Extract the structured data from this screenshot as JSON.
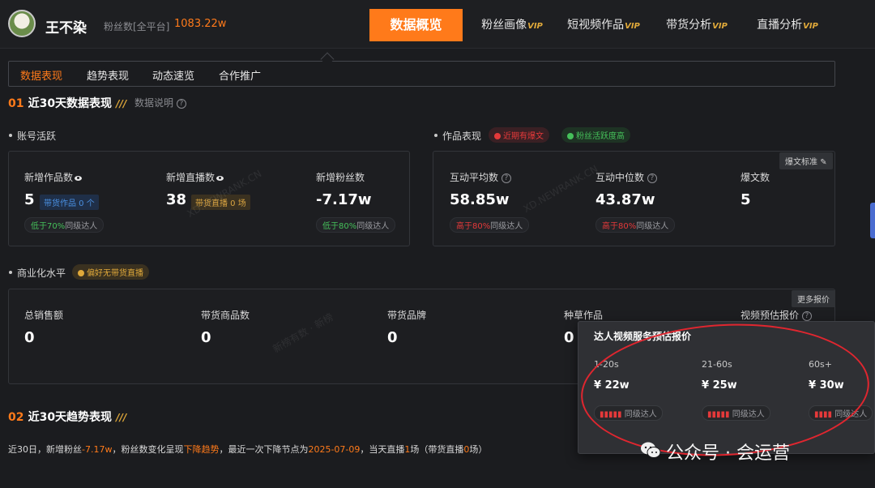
{
  "header": {
    "user_name": "王不染",
    "fans_label": "粉丝数[全平台]",
    "fans_value": "1083.22w",
    "tabs": [
      {
        "label": "数据概览",
        "vip": ""
      },
      {
        "label": "粉丝画像",
        "vip": "VIP"
      },
      {
        "label": "短视频作品",
        "vip": "VIP"
      },
      {
        "label": "带货分析",
        "vip": "VIP"
      },
      {
        "label": "直播分析",
        "vip": "VIP"
      }
    ]
  },
  "subtabs": [
    "数据表现",
    "趋势表现",
    "动态速览",
    "合作推广"
  ],
  "section1": {
    "num": "01",
    "title": "近30天数据表现",
    "mark": "///",
    "help": "数据说明"
  },
  "account": {
    "heading": "账号活跃",
    "metrics": [
      {
        "label": "新增作品数",
        "value": "5",
        "badge": "带货作品 0 个",
        "cmp_prefix": "低于",
        "cmp_pct": "70%",
        "cmp_suffix": "同级达人"
      },
      {
        "label": "新增直播数",
        "value": "38",
        "badge": "带货直播 0 场"
      },
      {
        "label": "新增粉丝数",
        "value": "-7.17w",
        "cmp_prefix": "低于",
        "cmp_pct": "80%",
        "cmp_suffix": "同级达人"
      }
    ]
  },
  "works": {
    "heading": "作品表现",
    "pill_red": "近期有爆文",
    "pill_green": "粉丝活跃度高",
    "corner": "爆文标准",
    "metrics": [
      {
        "label": "互动平均数",
        "value": "58.85w",
        "cmp_prefix": "高于",
        "cmp_pct": "80%",
        "cmp_suffix": "同级达人"
      },
      {
        "label": "互动中位数",
        "value": "43.87w",
        "cmp_prefix": "高于",
        "cmp_pct": "80%",
        "cmp_suffix": "同级达人"
      },
      {
        "label": "爆文数",
        "value": "5"
      }
    ]
  },
  "commerce": {
    "heading": "商业化水平",
    "pill": "偏好无带货直播",
    "corner": "更多报价",
    "metrics": [
      {
        "label": "总销售额",
        "value": "0"
      },
      {
        "label": "带货商品数",
        "value": "0"
      },
      {
        "label": "带货品牌",
        "value": "0"
      },
      {
        "label": "种草作品",
        "value": "0"
      },
      {
        "label": "视频预估报价",
        "value": ""
      }
    ]
  },
  "popup": {
    "title": "达人视频服务预估报价",
    "columns": [
      {
        "range": "1-20s",
        "price": "¥ 22w",
        "cmp_suffix": "同级达人"
      },
      {
        "range": "21-60s",
        "price": "¥ 25w",
        "cmp_suffix": "同级达人"
      },
      {
        "range": "60s+",
        "price": "¥ 30w",
        "cmp_suffix": "同级达人"
      }
    ]
  },
  "section2": {
    "num": "02",
    "title": "近30天趋势表现",
    "mark": "///"
  },
  "summary": {
    "p1": "近30日，新增粉丝",
    "fans": "-7.17w",
    "p2": "，粉丝数变化呈现",
    "trend": "下降趋势",
    "p3": "，最近一次下降节点为",
    "date": "2025-07-09",
    "p4": "，当天直播",
    "live_count": "1",
    "p5": "场（带货直播",
    "sell_count": "0",
    "p6": "场）"
  },
  "watermarks": [
    "XD.NEWRANK.CN",
    "XD.NEWRANK.CN",
    "新榜有数 · 新榜"
  ],
  "wechat": {
    "text": "公众号 · 会运营"
  }
}
